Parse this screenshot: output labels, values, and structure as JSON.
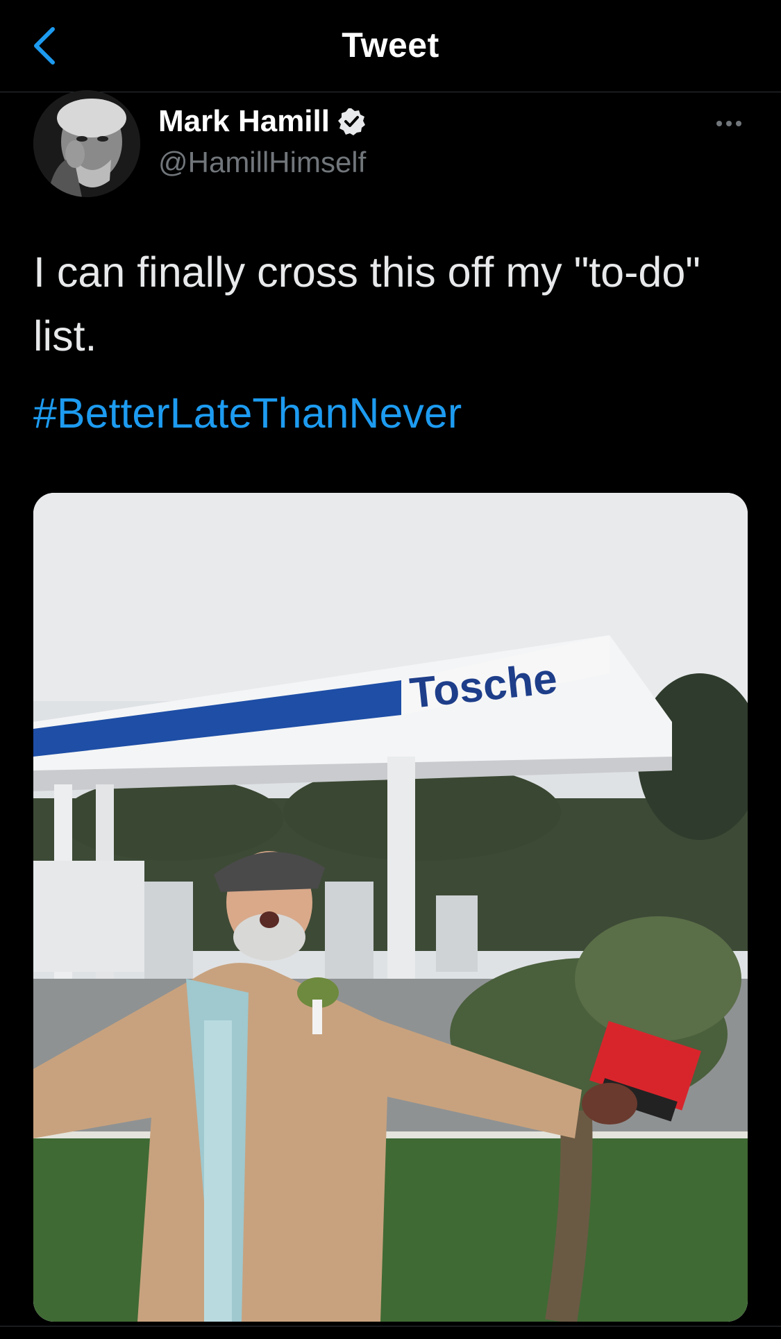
{
  "header": {
    "title": "Tweet",
    "back_icon": "chevron-left-icon"
  },
  "author": {
    "name": "Mark Hamill",
    "handle": "@HamillHimself",
    "verified_icon": "verified-badge-icon"
  },
  "tweet": {
    "text": "I can finally cross this off my \"to-do\" list.",
    "hashtag": "#BetterLateThanNever"
  },
  "media": {
    "sign_text": "Tosche"
  },
  "colors": {
    "background": "#000000",
    "accent": "#1d9bf0",
    "muted": "#71767b"
  }
}
